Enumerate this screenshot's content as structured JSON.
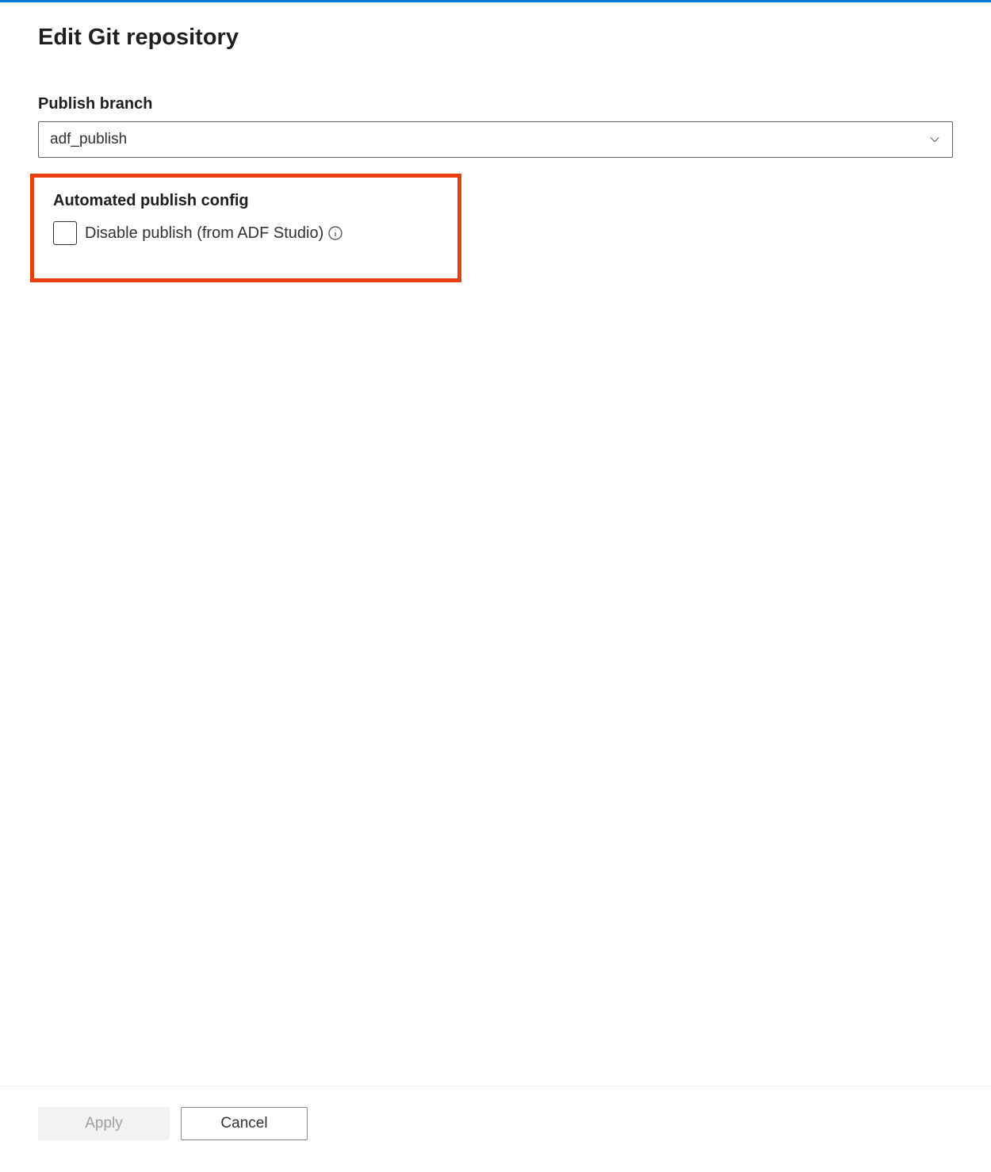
{
  "title": "Edit Git repository",
  "publishBranch": {
    "label": "Publish branch",
    "value": "adf_publish"
  },
  "automatedPublish": {
    "label": "Automated publish config",
    "checkboxLabel": "Disable publish (from ADF Studio)",
    "checked": false
  },
  "buttons": {
    "apply": "Apply",
    "cancel": "Cancel"
  }
}
